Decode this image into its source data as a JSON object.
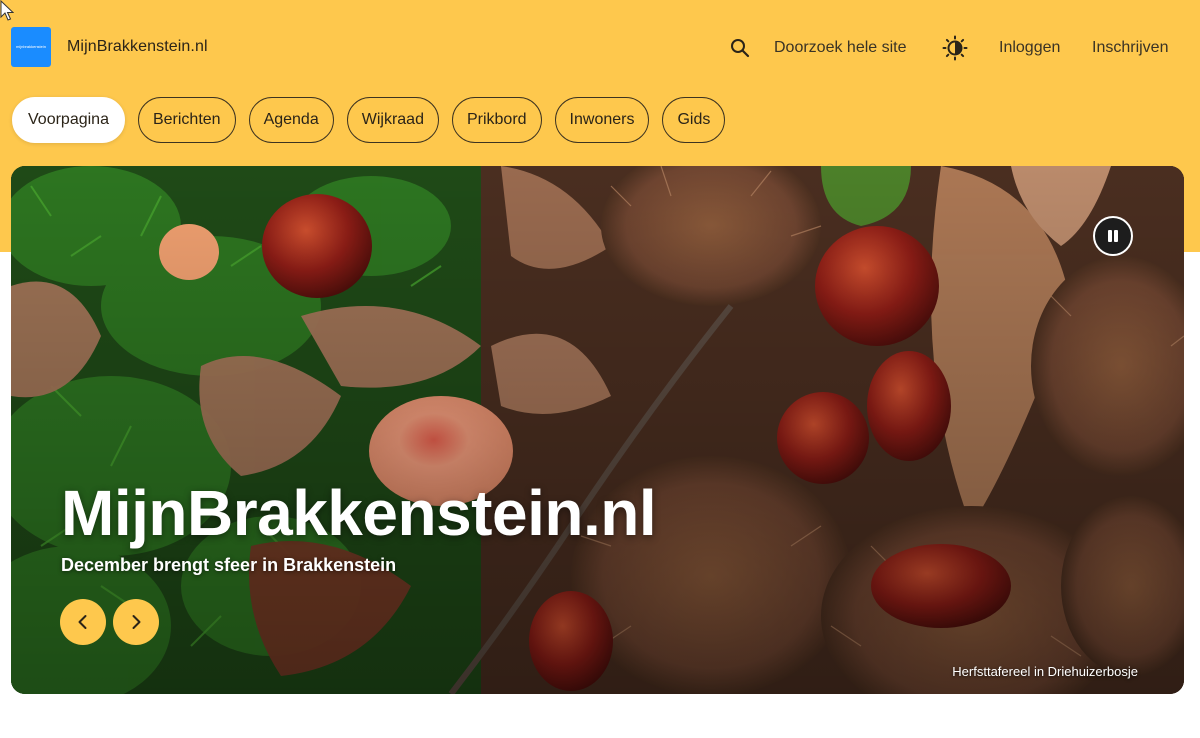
{
  "colors": {
    "accent": "#fec84d",
    "logo_bg": "#1a8cff",
    "text": "#2b2418"
  },
  "header": {
    "logo_text": "mijnbrakkenstein",
    "site_name": "MijnBrakkenstein.nl",
    "search_icon": "search-icon",
    "search_label": "Doorzoek hele site",
    "theme_icon": "brightness-icon",
    "login_label": "Inloggen",
    "signup_label": "Inschrijven"
  },
  "nav": {
    "items": [
      {
        "label": "Voorpagina",
        "active": true
      },
      {
        "label": "Berichten"
      },
      {
        "label": "Agenda"
      },
      {
        "label": "Wijkraad"
      },
      {
        "label": "Prikbord"
      },
      {
        "label": "Inwoners"
      },
      {
        "label": "Gids"
      }
    ]
  },
  "hero": {
    "title": "MijnBrakkenstein.nl",
    "subtitle": "December brengt sfeer in Brakkenstein",
    "caption": "Herfsttafereel in Driehuizerbosje",
    "prev_icon": "chevron-left-icon",
    "next_icon": "chevron-right-icon",
    "pause_icon": "pause-icon"
  }
}
